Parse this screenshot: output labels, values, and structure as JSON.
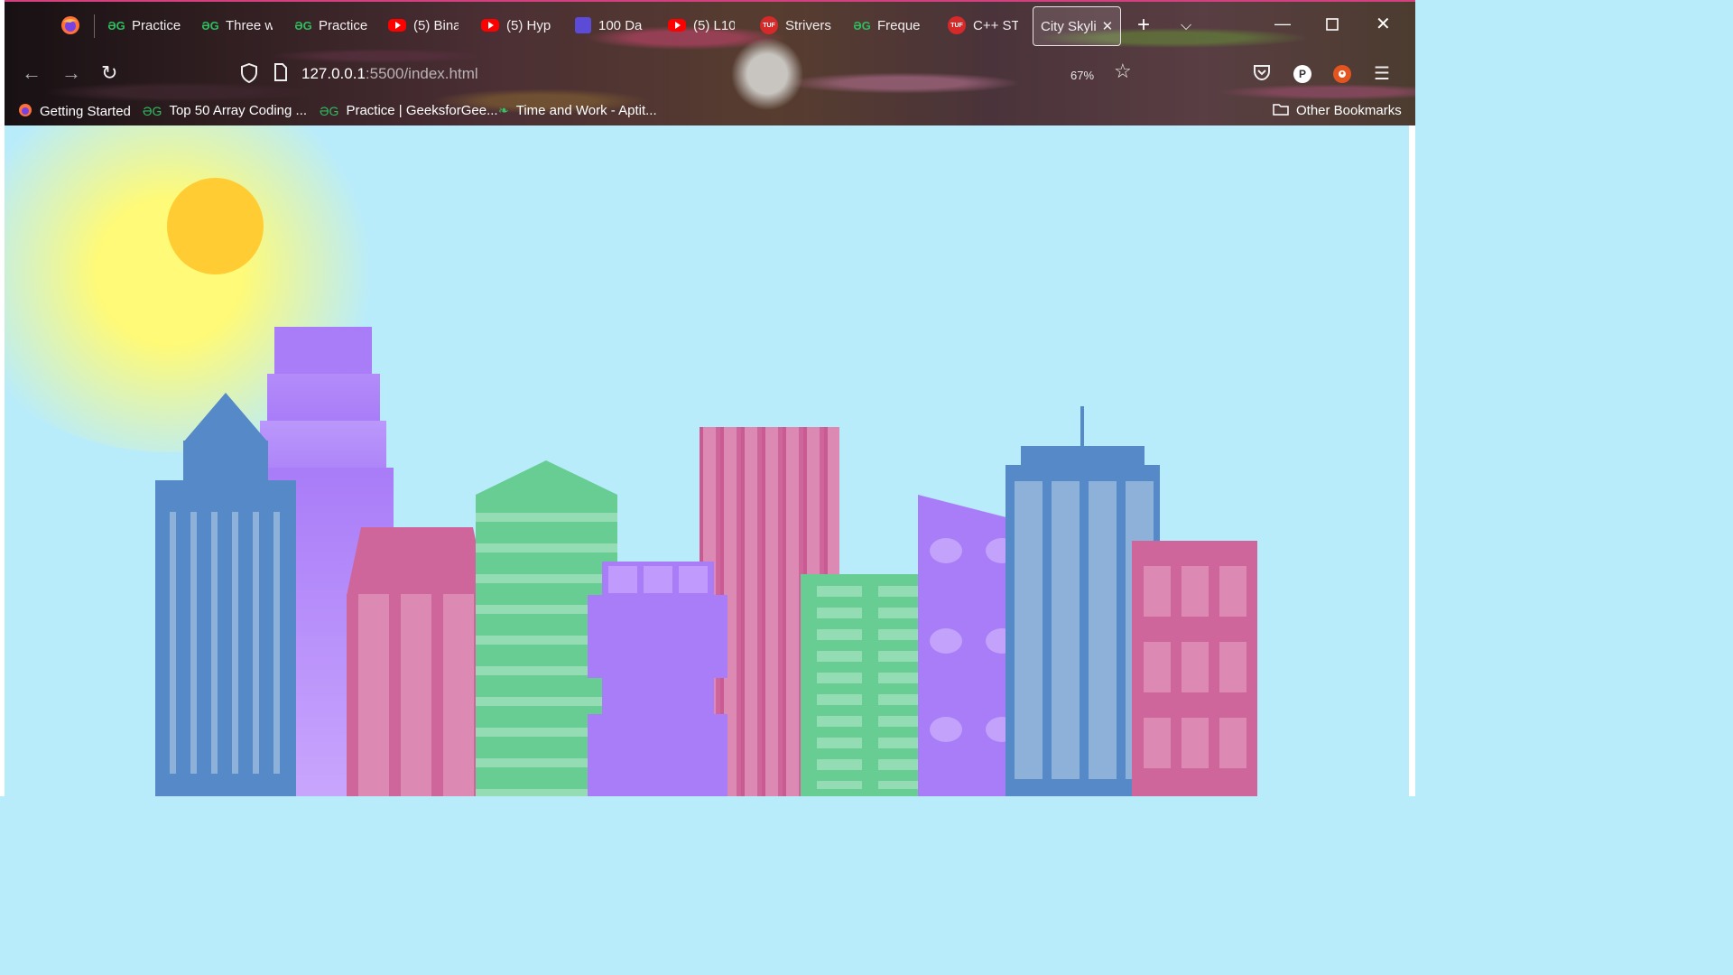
{
  "tabs": [
    {
      "label": "Practice",
      "icon": "gfg"
    },
    {
      "label": "Three w",
      "icon": "gfg"
    },
    {
      "label": "Practice",
      "icon": "gfg"
    },
    {
      "label": "(5) Bina",
      "icon": "youtube"
    },
    {
      "label": "(5) Hyp",
      "icon": "youtube"
    },
    {
      "label": "100 Da",
      "icon": "calendar"
    },
    {
      "label": "(5) L10",
      "icon": "youtube"
    },
    {
      "label": "Strivers",
      "icon": "tuf"
    },
    {
      "label": "Freque",
      "icon": "gfg"
    },
    {
      "label": "C++ ST",
      "icon": "tuf"
    },
    {
      "label": "City Skyli",
      "icon": "none",
      "active": true
    }
  ],
  "toolbar": {
    "url_host": "127.0.0.1",
    "url_path": ":5500/index.html",
    "zoom": "67%",
    "profile_letter": "P",
    "tuf_icon_text": "TUF"
  },
  "bookmarks": [
    {
      "label": "Getting Started"
    },
    {
      "label": "Top 50 Array Coding ..."
    },
    {
      "label": "Practice | GeeksforGee..."
    },
    {
      "label": "Time and Work - Aptit..."
    }
  ],
  "other_bookmarks": "Other Bookmarks",
  "colors": {
    "sky": "#b9ecfb",
    "sun": "#ffcc33",
    "glow": "#fffa77",
    "blue": "#5589c7",
    "blue_light": "#8db1d9",
    "purple": "#a97cf8",
    "purple_light": "#c9a6fd",
    "pink": "#ce669b",
    "pink_light": "#dc8ab3",
    "green": "#67cd93",
    "green_light": "#93dcb4"
  }
}
